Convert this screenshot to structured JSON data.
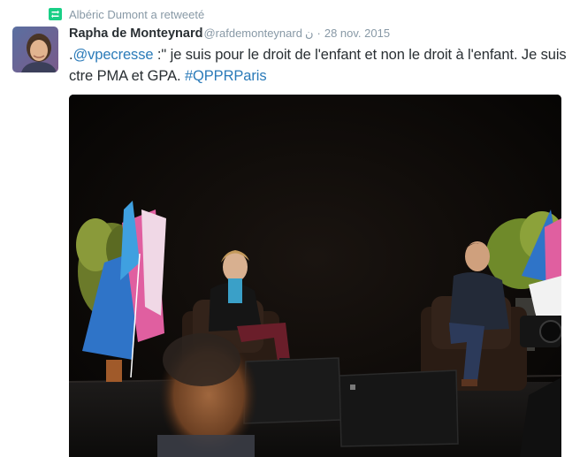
{
  "retweet": {
    "text": "Albéric Dumont a retweeté",
    "icon": "retweet-icon",
    "color": "#8899a6",
    "icon_color": "#19cf86"
  },
  "tweet": {
    "author_name": "Rapha de Monteynard",
    "author_handle": "@rafdemonteynard",
    "extra_glyph": "ن",
    "separator": "·",
    "date": "28 nov. 2015",
    "text_prefix": ".",
    "mention": "@vpecresse",
    "text_body": " :\" je suis pour le droit de l'enfant et non le droit à l'enfant. Je suis ctre PMA et GPA. ",
    "hashtag": "#QPPRParis",
    "link_color": "#2b7bb9"
  },
  "photo": {
    "icon": "event-stage-photo"
  }
}
